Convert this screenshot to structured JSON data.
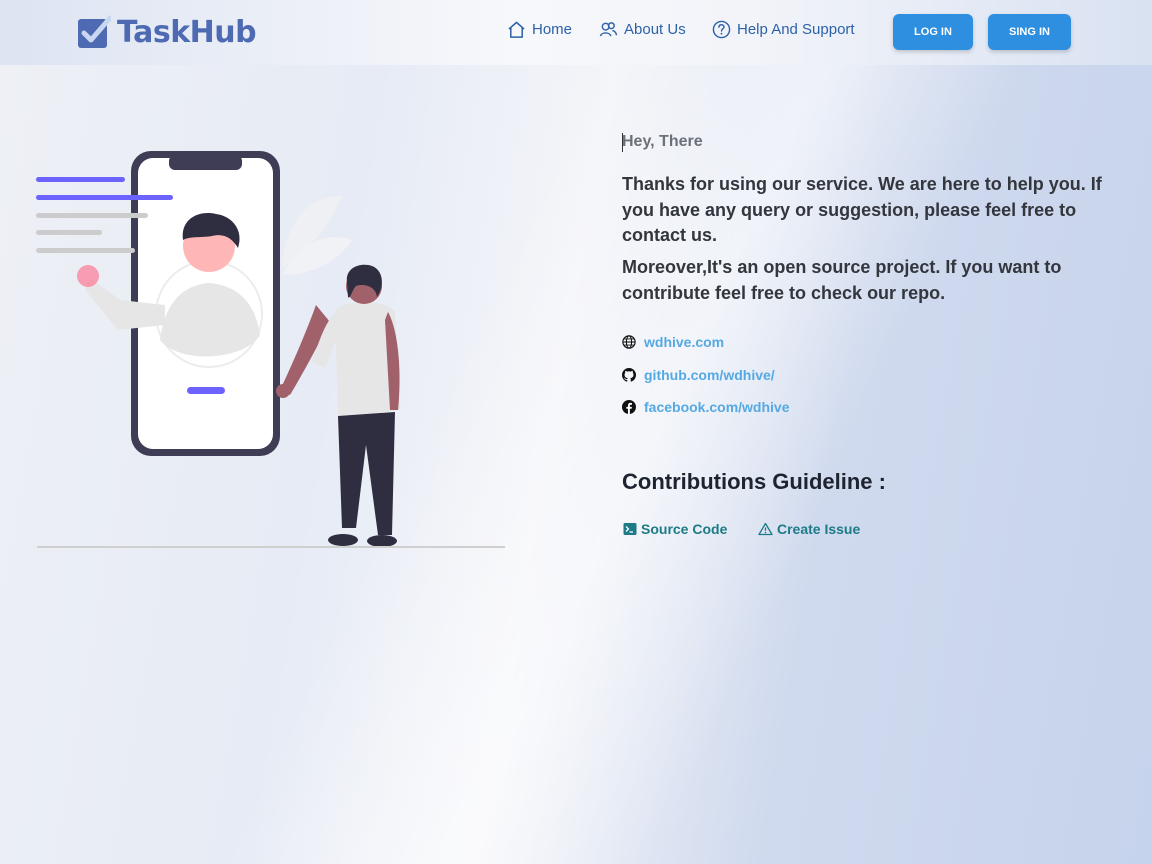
{
  "brand": {
    "name": "TaskHub",
    "color": "#4e6ab3"
  },
  "nav": {
    "items": [
      {
        "label": "Home",
        "icon": "home-icon"
      },
      {
        "label": "About Us",
        "icon": "users-icon"
      },
      {
        "label": "Help And Support",
        "icon": "question-circle-icon"
      }
    ],
    "login_label": "LOG IN",
    "signin_label": "SING IN",
    "accent": "#2e8ee0"
  },
  "content": {
    "greeting": "Hey, There",
    "paragraph1": "Thanks for using our service. We are here to help you. If you have any query or suggestion, please feel free to contact us.",
    "paragraph2": "Moreover,It's an open source project. If you want to contribute feel free to check our repo.",
    "links": [
      {
        "label": "wdhive.com",
        "icon": "globe-icon"
      },
      {
        "label": "github.com/wdhive/",
        "icon": "github-icon"
      },
      {
        "label": "facebook.com/wdhive",
        "icon": "facebook-icon"
      }
    ],
    "contrib_heading": "Contributions Guideline :",
    "contrib_links": [
      {
        "label": "Source Code",
        "icon": "terminal-icon"
      },
      {
        "label": "Create Issue",
        "icon": "warning-icon"
      }
    ]
  }
}
